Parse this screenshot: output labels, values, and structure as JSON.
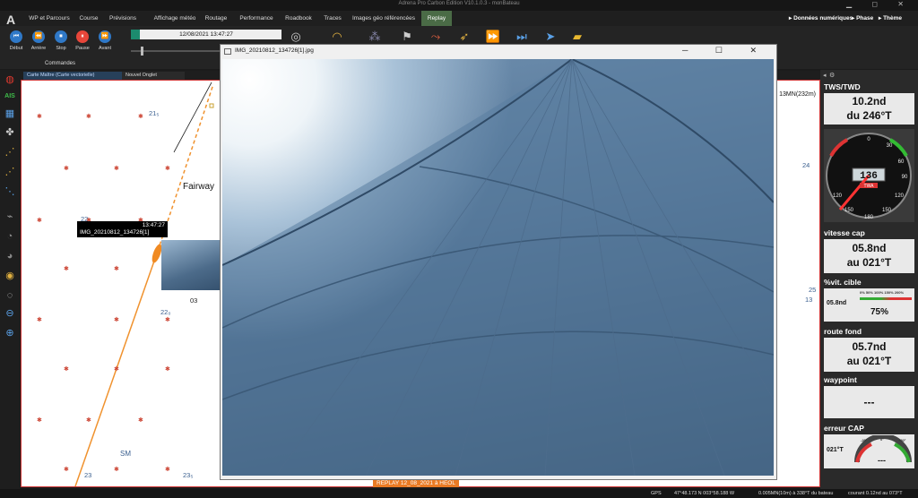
{
  "window": {
    "title": "Adrena Pro Carbon Edition V10.1.0.3 - monBateau",
    "controls": "▁ ◻ ✕"
  },
  "menu": {
    "items": [
      "WP et Parcours",
      "Course",
      "Prévisions",
      "Affichage météo",
      "Routage",
      "Performance",
      "Roadbook",
      "Traces",
      "Images géo référencées",
      "Replay"
    ],
    "active": "Replay",
    "right_items": [
      "Données numériques",
      "Phase",
      "Thème"
    ]
  },
  "toolbar": {
    "buttons": [
      {
        "label": "Début",
        "glyph": "⏮"
      },
      {
        "label": "Arrière",
        "glyph": "⏪"
      },
      {
        "label": "Stop",
        "glyph": "⏹"
      },
      {
        "label": "Pause",
        "glyph": "⏸"
      },
      {
        "label": "Avant",
        "glyph": "⏩"
      }
    ],
    "commands_label": "Commandes",
    "time": "12/08/2021 13:47:27"
  },
  "tabs": {
    "chart": "Carte Maître (Carte vectorielle)",
    "new": "Nouvel Onglet"
  },
  "chart": {
    "fairway": "Fairway",
    "sm": "SM",
    "scale": "13MN(232m)",
    "depths": [
      "21₅",
      "22",
      "22₀",
      "24",
      "25",
      "13",
      "23",
      "23₅",
      "03"
    ],
    "tooltip": {
      "time": "13:47:27",
      "file": "IMG_20210812_134726[1]"
    },
    "replay_label": "REPLAY 12_08_2021 à HEOL"
  },
  "image_window": {
    "title": "IMG_20210812_134726[1].jpg",
    "controls": "─ ☐ ✕"
  },
  "gauges": {
    "tws_twd": {
      "title": "TWS/TWD",
      "line1": "10.2nd",
      "line2": "du 246°T",
      "dial_value": "136",
      "dial_tag": "TWA",
      "ticks": [
        "0",
        "30",
        "60",
        "90",
        "120",
        "150",
        "180",
        "150",
        "120"
      ]
    },
    "speed_cap": {
      "title": "vitesse cap",
      "line1": "05.8nd",
      "line2": "au 021°T"
    },
    "target": {
      "title": "%vit. cible",
      "left": "05.8nd",
      "value": "75%",
      "scale": [
        "0%",
        "50%",
        "100%",
        "150%",
        "200%"
      ]
    },
    "route": {
      "title": "route fond",
      "line1": "05.7nd",
      "line2": "au 021°T"
    },
    "waypoint": {
      "title": "waypoint",
      "value": "---"
    },
    "cap_error": {
      "title": "erreur CAP",
      "left": "021°T",
      "value": "---",
      "scale": [
        "-20°",
        "0°",
        "+20°"
      ]
    }
  },
  "status": {
    "gps": "GPS",
    "position": "47°48.173 N  003°58.188 W",
    "info": "0.005MN(10m) à 338°T du bateau",
    "current": "courant 0.12nd au 073°T"
  }
}
